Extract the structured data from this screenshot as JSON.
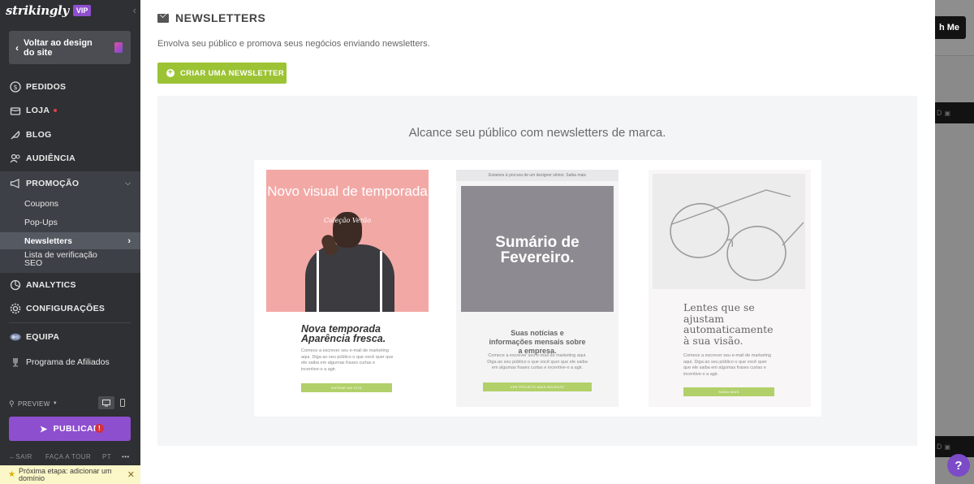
{
  "sidebar": {
    "logo": "strikingly",
    "vip_badge": "VIP",
    "back_button": "Voltar ao design do site",
    "items": [
      {
        "label": "PEDIDOS",
        "icon": "dollar-circle-icon"
      },
      {
        "label": "LOJA",
        "icon": "store-icon"
      },
      {
        "label": "BLOG",
        "icon": "feather-icon"
      },
      {
        "label": "AUDIÊNCIA",
        "icon": "users-icon"
      },
      {
        "label": "PROMOÇÃO",
        "icon": "megaphone-icon"
      },
      {
        "label": "ANALYTICS",
        "icon": "pie-chart-icon"
      },
      {
        "label": "CONFIGURAÇÕES",
        "icon": "gear-icon"
      },
      {
        "label": "EQUIPA",
        "icon": "team-icon"
      },
      {
        "label": "Programa de Afiliados",
        "icon": "trophy-icon"
      }
    ],
    "promo_sub_items": [
      "Coupons",
      "Pop-Ups",
      "Newsletters",
      "Lista de verificação SEO"
    ],
    "preview_label": "PREVIEW",
    "publish_label": "PUBLICAR",
    "publish_warning": "!",
    "bottom_links": {
      "exit": "SAIR",
      "tour": "FAÇA A TOUR",
      "lang": "PT",
      "more": "•••"
    },
    "next_step": "Próxima etapa: adicionar um domínio"
  },
  "main": {
    "title": "NEWSLETTERS",
    "subtitle": "Envolva seu público e promova seus negócios enviando newsletters.",
    "create_button": "CRIAR UMA NEWSLETTER",
    "showcase_title": "Alcance seu público com newsletters de marca.",
    "cards": [
      {
        "headline": "Novo visual de temporada",
        "subheadline": "Coleção Verão",
        "body_title": "Nova temporada Aparência fresca.",
        "body_text": "Comece a escrever seu e-mail de marketing aqui. Diga ao seu público o que você quer que ele saiba em algumas frases curtas e incentive-o a agir.",
        "cta": "ENTRAR NO SITE"
      },
      {
        "top_bar": "Estamos à procura de um designer sênior. Saiba mais",
        "headline": "Sumário de Fevereiro.",
        "body_title": "Suas notícias e informações mensais sobre a empresa.",
        "body_text": "Comece a escrever seu e-mail de marketing aqui. Diga ao seu público o que você quer que ele saiba em algumas frases curtas e incentive-o a agir.",
        "cta": "VER PROJETO MAIS RECENTE"
      },
      {
        "headline": "Lentes que se ajustam automaticamente à sua visão.",
        "body_text": "Comece a escrever seu e-mail de marketing aqui. Diga ao seu público o que você quer que ele saiba em algumas frases curtas e incentive-o a agir.",
        "cta": "SAIBA MAIS"
      }
    ]
  },
  "background": {
    "button_fragment": "h Me",
    "bar_text": "D"
  },
  "help_button": "?",
  "colors": {
    "sidebar_bg": "#2f3033",
    "accent_purple": "#8e4fcf",
    "accent_green": "#9cc334",
    "card1_bg": "#f2a9a6"
  }
}
